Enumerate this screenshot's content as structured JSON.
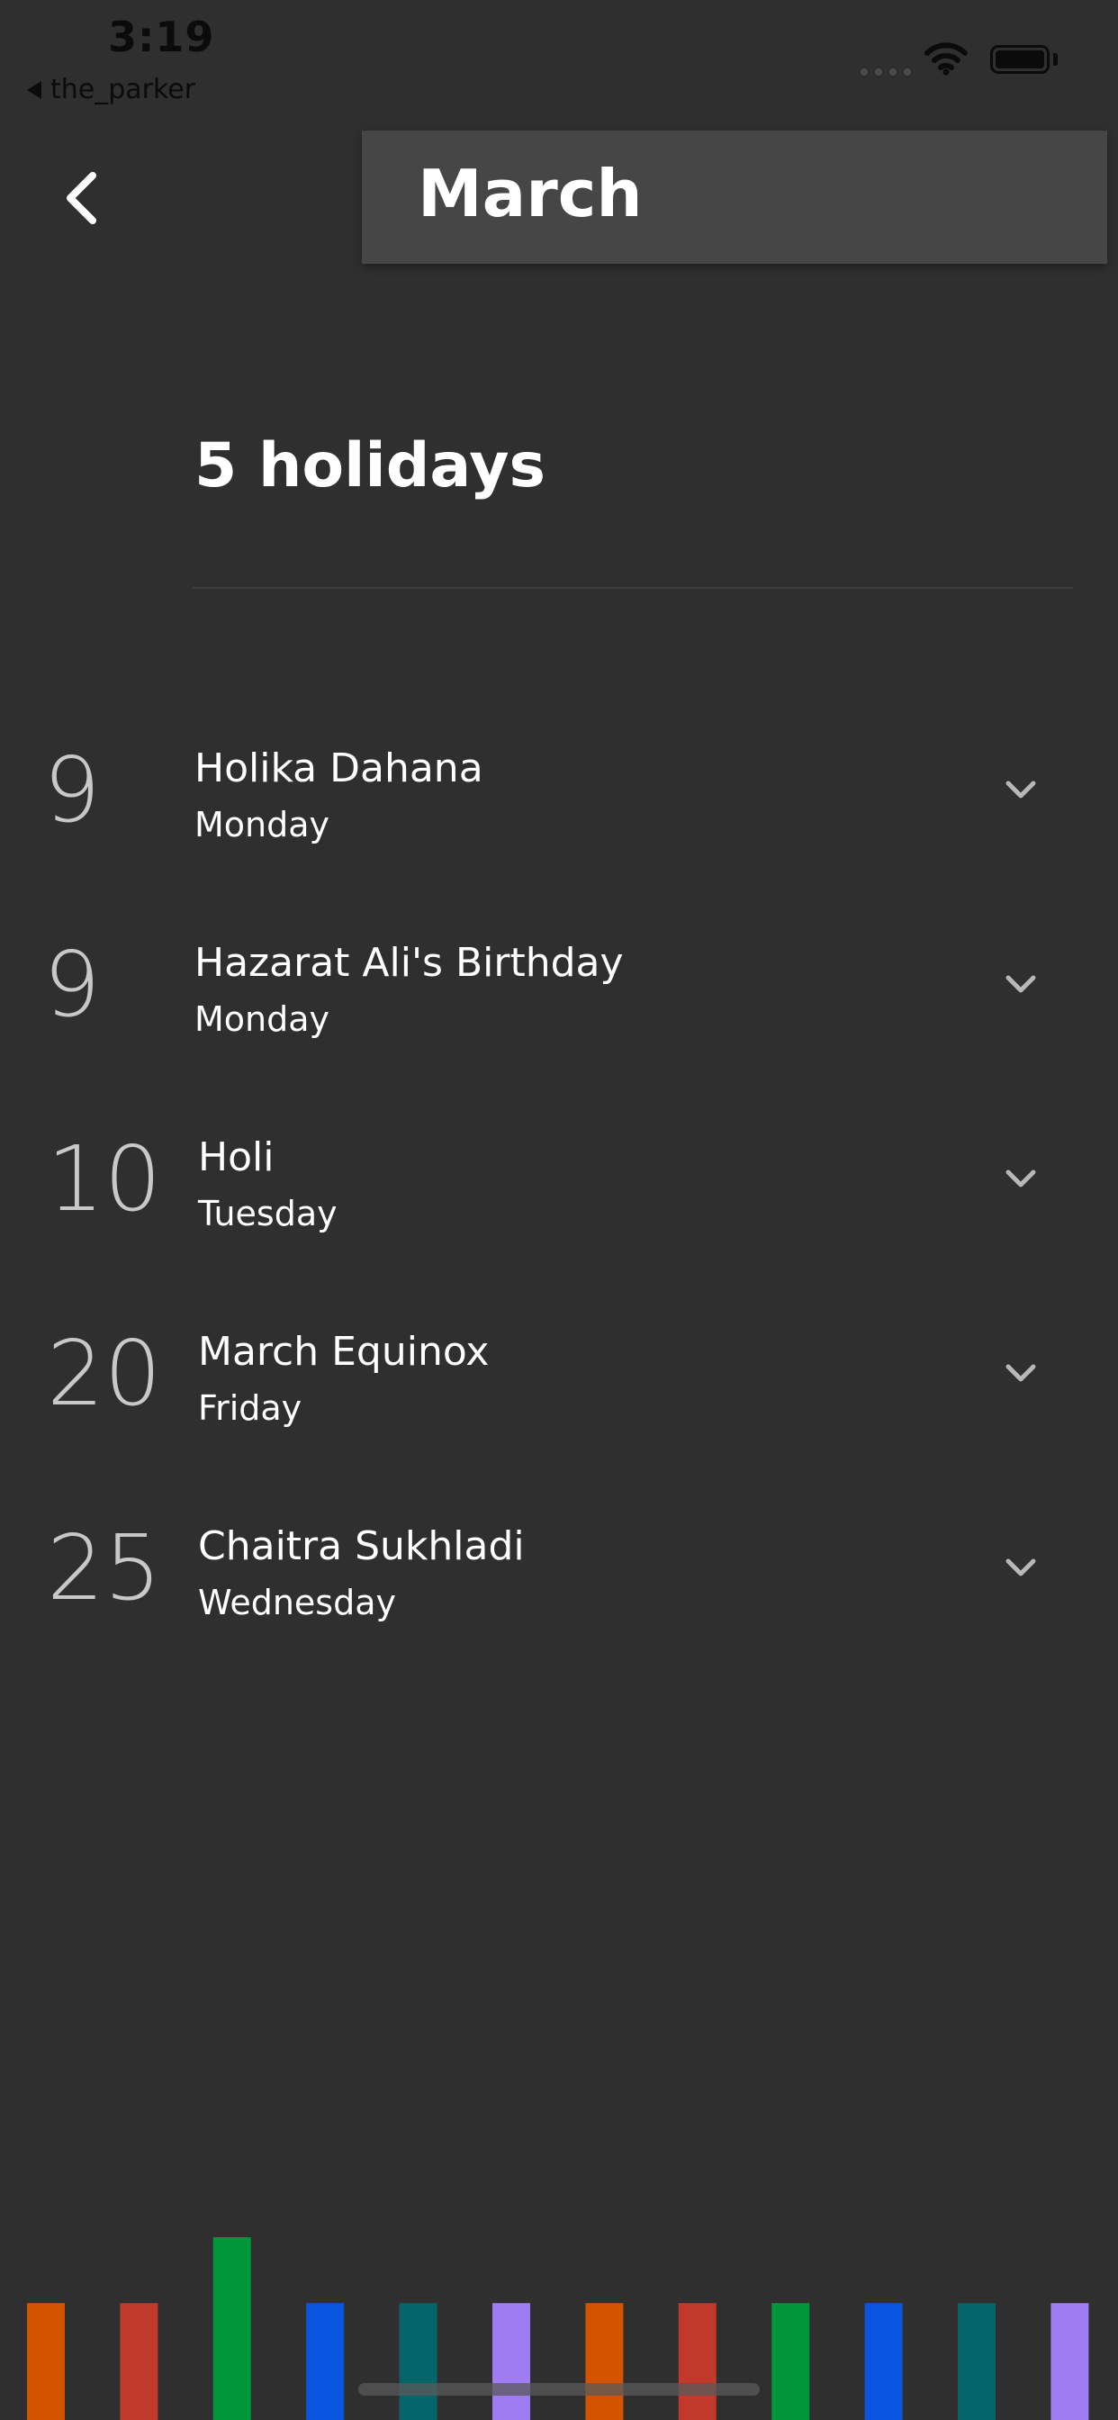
{
  "status_bar": {
    "time": "3:19",
    "back_app": "the_parker"
  },
  "header": {
    "back_icon": "chevron-left-icon",
    "month": "March"
  },
  "summary": {
    "count_label": "5 holidays"
  },
  "holidays": [
    {
      "day": "9",
      "name": "Holika Dahana",
      "weekday": "Monday"
    },
    {
      "day": "9",
      "name": "Hazarat Ali's Birthday",
      "weekday": "Monday"
    },
    {
      "day": "10",
      "name": "Holi",
      "weekday": "Tuesday"
    },
    {
      "day": "20",
      "name": "March Equinox",
      "weekday": "Friday"
    },
    {
      "day": "25",
      "name": "Chaitra Sukhladi",
      "weekday": "Wednesday"
    }
  ],
  "decor_bars": [
    {
      "color": "#d35400",
      "level": 0.55
    },
    {
      "color": "#c0392b",
      "level": 0.55
    },
    {
      "color": "#00963a",
      "level": 0.86
    },
    {
      "color": "#0a55e0",
      "level": 0.55
    },
    {
      "color": "#04666a",
      "level": 0.55
    },
    {
      "color": "#a07cf2",
      "level": 0.55
    },
    {
      "color": "#d35400",
      "level": 0.55
    },
    {
      "color": "#c0392b",
      "level": 0.55
    },
    {
      "color": "#00963a",
      "level": 0.55
    },
    {
      "color": "#0a55e0",
      "level": 0.55
    },
    {
      "color": "#04666a",
      "level": 0.55
    },
    {
      "color": "#a07cf2",
      "level": 0.55
    }
  ],
  "colors": {
    "background": "#2f2f2f",
    "header_panel": "#464646",
    "day_number": "#c8c8c8",
    "text": "#ffffff"
  }
}
